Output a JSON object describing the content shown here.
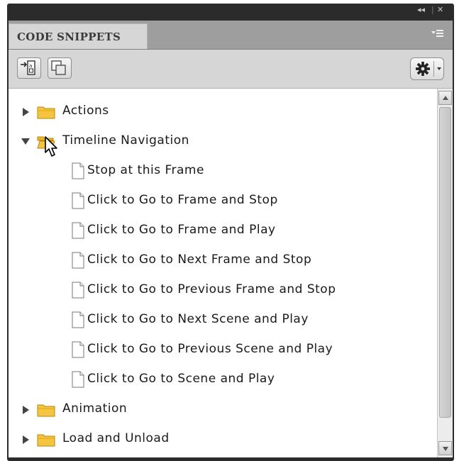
{
  "window": {
    "collapse_label": "◂◂",
    "separator": "|",
    "close_label": "✕"
  },
  "panel": {
    "title": "CODE SNIPPETS"
  },
  "toolbar": {
    "insert_icon": "insert-code-icon",
    "copy_icon": "copy-to-clipboard-icon",
    "options_icon": "gear-icon"
  },
  "tree": [
    {
      "label": "Actions",
      "type": "folder",
      "expanded": false
    },
    {
      "label": "Timeline Navigation",
      "type": "folder",
      "expanded": true
    },
    {
      "label": "Stop at this Frame",
      "type": "snippet"
    },
    {
      "label": "Click to Go to Frame and Stop",
      "type": "snippet"
    },
    {
      "label": "Click to Go to Frame and Play",
      "type": "snippet"
    },
    {
      "label": "Click to Go to Next Frame and Stop",
      "type": "snippet"
    },
    {
      "label": "Click to Go to Previous Frame and Stop",
      "type": "snippet"
    },
    {
      "label": "Click to Go to Next Scene and Play",
      "type": "snippet"
    },
    {
      "label": "Click to Go to Previous Scene and Play",
      "type": "snippet"
    },
    {
      "label": "Click to Go to Scene and Play",
      "type": "snippet"
    },
    {
      "label": "Animation",
      "type": "folder",
      "expanded": false
    },
    {
      "label": "Load and Unload",
      "type": "folder",
      "expanded": false
    }
  ],
  "colors": {
    "frame": "#2b2b2b",
    "tab_row": "#9e9e9e",
    "panel_bg": "#d6d6d6",
    "folder_fill": "#f5c542",
    "folder_edge": "#b8860b"
  }
}
